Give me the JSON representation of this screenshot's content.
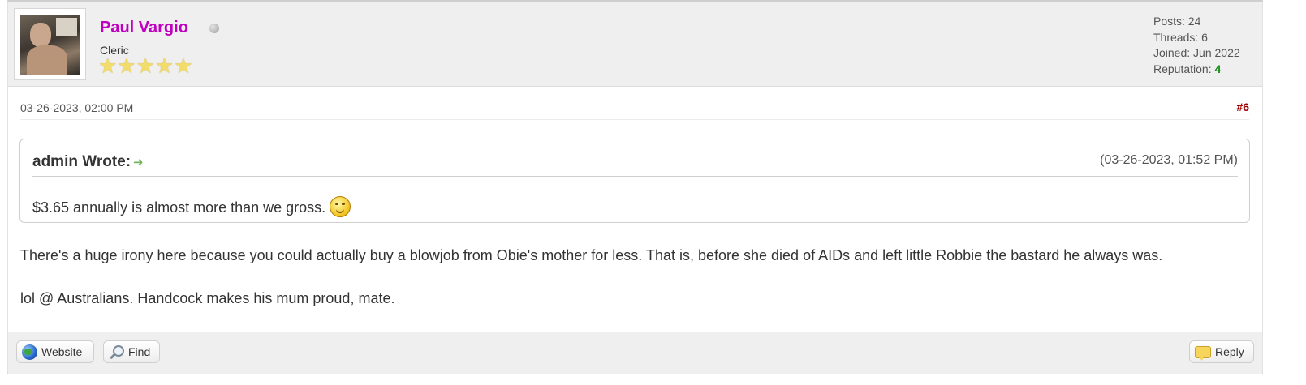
{
  "author": {
    "username": "Paul Vargio",
    "usertitle": "Cleric",
    "stars": "★★★★★",
    "online_status": "offline",
    "stats": {
      "posts_label": "Posts:",
      "posts": "24",
      "threads_label": "Threads:",
      "threads": "6",
      "joined_label": "Joined:",
      "joined": "Jun 2022",
      "reputation_label": "Reputation:",
      "reputation": "4"
    }
  },
  "post": {
    "date": "03-26-2023, 02:00 PM",
    "number": "#6",
    "quote": {
      "author": "admin Wrote:",
      "arrow": "➜",
      "date": "(03-26-2023, 01:52 PM)",
      "text": "$3.65 annually is almost more than we gross.",
      "smiley": "smile-icon"
    },
    "paragraphs": [
      "There's a huge irony here because you could actually buy a blowjob from Obie's mother for less. That is, before she died of AIDs and left little Robbie the bastard he always was.",
      "lol @ Australians. Handcock makes his mum proud, mate."
    ]
  },
  "buttons": {
    "website": "Website",
    "find": "Find",
    "reply": "Reply"
  },
  "colors": {
    "username": "#c000c0",
    "post_number": "#a00000",
    "reputation": "#188f18",
    "header_bg": "#efefef"
  }
}
